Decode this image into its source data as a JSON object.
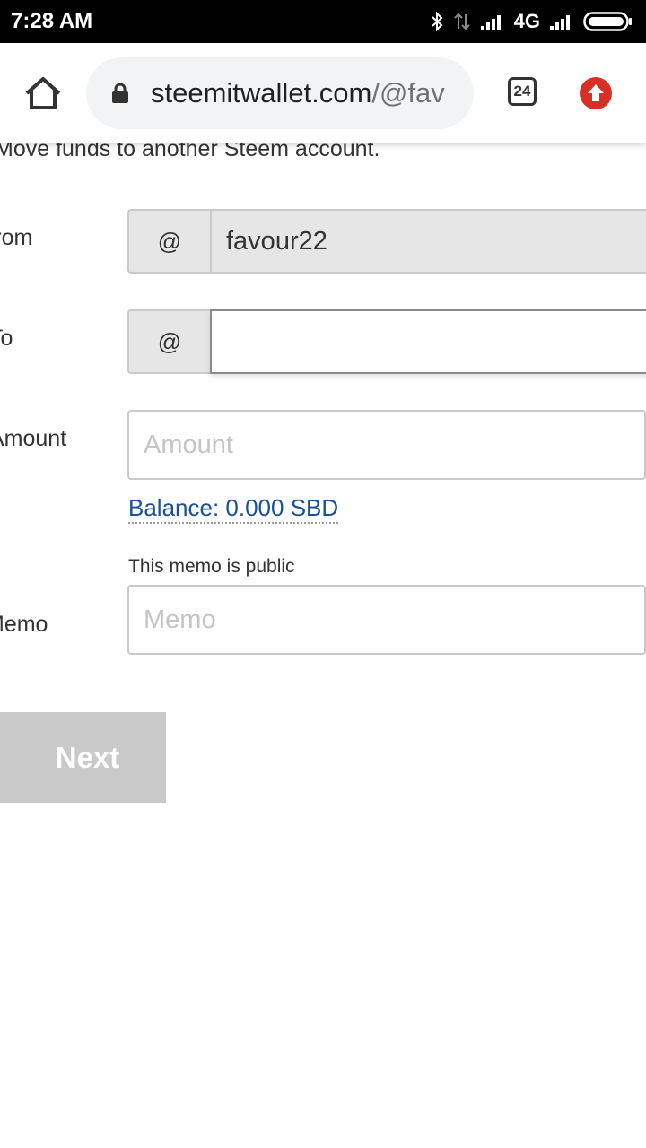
{
  "status_bar": {
    "time": "7:28 AM",
    "network": "4G",
    "icons": [
      "bluetooth-icon",
      "data-transfer-icon",
      "signal-icon",
      "battery-icon"
    ]
  },
  "browser": {
    "url_host": "steemitwallet.com",
    "url_path": "/@fav",
    "tab_count": "24",
    "icons": [
      "home-icon",
      "lock-icon",
      "tabs-icon",
      "update-icon"
    ],
    "colors": {
      "update_badge": "#d93025",
      "pill": "#f1f3f4"
    }
  },
  "form": {
    "intro": "Move funds to another Steem account.",
    "from_label": "From",
    "from_prefix": "@",
    "from_value": "favour22",
    "to_label": "To",
    "to_prefix": "@",
    "to_value": "",
    "amount_label": "Amount",
    "amount_placeholder": "Amount",
    "balance_text": "Balance: 0.000 SBD",
    "memo_note": "This memo is public",
    "memo_label": "Memo",
    "memo_placeholder": "Memo",
    "next_label": "Next",
    "colors": {
      "link": "#1a5099",
      "disabled_button": "#c9c9c9"
    }
  }
}
